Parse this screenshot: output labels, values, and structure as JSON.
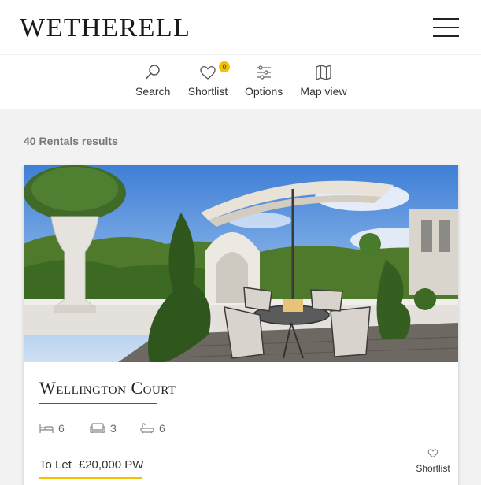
{
  "header": {
    "logo": "WETHERELL",
    "menu_icon": "hamburger-menu-icon"
  },
  "toolbar": {
    "search_label": "Search",
    "shortlist_label": "Shortlist",
    "shortlist_count": "0",
    "options_label": "Options",
    "map_label": "Map view",
    "icons": [
      "search-icon",
      "heart-icon",
      "sliders-icon",
      "map-icon"
    ]
  },
  "results": {
    "count_text": "40 Rentals results"
  },
  "listing": {
    "title": "Wellington Court",
    "bedrooms": "6",
    "receptions": "3",
    "bathrooms": "6",
    "status": "To Let",
    "price": "£20,000 PW",
    "shortlist_label": "Shortlist",
    "feature_icons": [
      "bed-icon",
      "sofa-icon",
      "bath-icon"
    ]
  },
  "colors": {
    "accent": "#f2c200",
    "background": "#f2f2f2",
    "text": "#333333"
  }
}
